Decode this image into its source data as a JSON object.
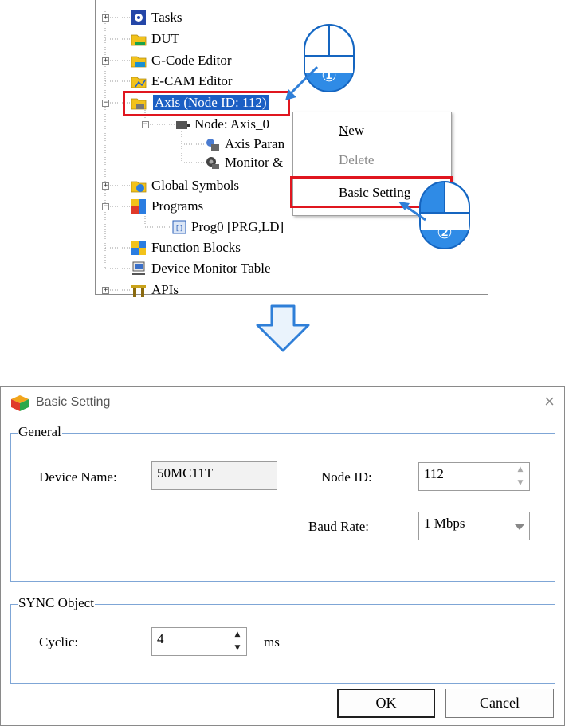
{
  "tree": {
    "items": [
      {
        "label": "Tasks",
        "icon": "gear-icon"
      },
      {
        "label": "DUT",
        "icon": "folder-icon"
      },
      {
        "label": "G-Code Editor",
        "icon": "folder-icon"
      },
      {
        "label": "E-CAM Editor",
        "icon": "folder-icon"
      },
      {
        "label": "Axis (Node ID: 112)",
        "icon": "folder-icon"
      },
      {
        "label": "Node: Axis_0",
        "icon": "motor-icon"
      },
      {
        "label": "Axis Paran",
        "icon": "axis-parameter-icon"
      },
      {
        "label": "Monitor &",
        "icon": "monitor-icon"
      },
      {
        "label": "Global Symbols",
        "icon": "folder-icon"
      },
      {
        "label": "Programs",
        "icon": "programs-icon"
      },
      {
        "label": "Prog0 [PRG,LD]",
        "icon": "program-icon"
      },
      {
        "label": "Function Blocks",
        "icon": "function-blocks-icon"
      },
      {
        "label": "Device Monitor Table",
        "icon": "device-monitor-icon"
      },
      {
        "label": "APIs",
        "icon": "api-icon"
      }
    ]
  },
  "context_menu": {
    "new": "ew",
    "new_accel": "N",
    "delete": "Delete",
    "basic_setting": "Basic Setting"
  },
  "badges": {
    "step1": "①",
    "step2": "②"
  },
  "dialog": {
    "title": "Basic Setting",
    "close": "×",
    "general_title": "General",
    "device_name_label": "Device Name:",
    "device_name_value": "50MC11T",
    "node_id_label": "Node ID:",
    "node_id_value": "112",
    "baud_rate_label": "Baud Rate:",
    "baud_rate_value": "1 Mbps",
    "sync_title": "SYNC Object",
    "cyclic_label": "Cyclic:",
    "cyclic_value": "4",
    "cyclic_unit": "ms",
    "ok": "OK",
    "cancel": "Cancel"
  },
  "colors": {
    "highlight": "#e0161f",
    "selection": "#1b5fc4",
    "arrow": "#2f7fd8",
    "group_border": "#7fa6d6"
  }
}
